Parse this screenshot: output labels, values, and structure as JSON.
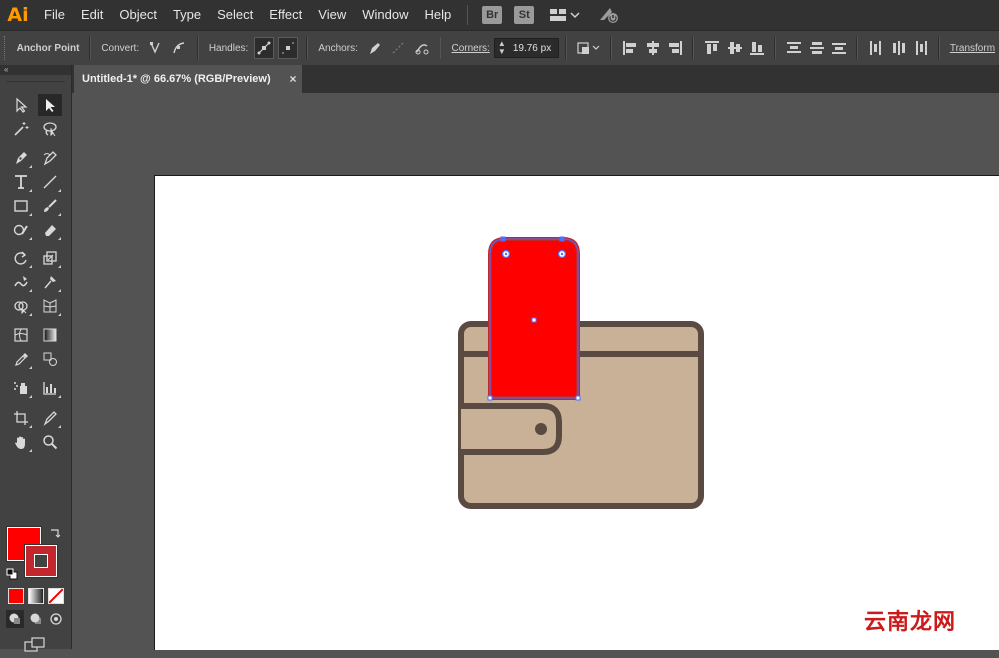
{
  "app": {
    "logo": "Ai"
  },
  "menu": [
    "File",
    "Edit",
    "Object",
    "Type",
    "Select",
    "Effect",
    "View",
    "Window",
    "Help"
  ],
  "app_badges": [
    "Br",
    "St"
  ],
  "control_bar": {
    "anchor_point_label": "Anchor Point",
    "convert_label": "Convert:",
    "handles_label": "Handles:",
    "anchors_label": "Anchors:",
    "corners_label": "Corners:",
    "corners_value": "19.76 px",
    "transform_label": "Transform"
  },
  "tool_panel": {
    "collapse": "«"
  },
  "document_tab": {
    "title": "Untitled-1* @ 66.67% (RGB/Preview)",
    "close": "×"
  },
  "colors": {
    "fill": "#ff0000",
    "stroke": "#c1272d",
    "wallet_body": "#c8b196",
    "wallet_outline": "#5a4a42",
    "card": "#ff0000",
    "selection": "#4f6fff"
  },
  "watermark": "云南龙网"
}
